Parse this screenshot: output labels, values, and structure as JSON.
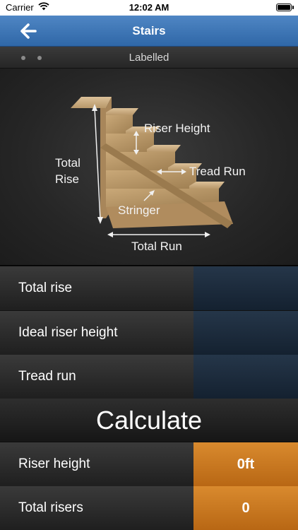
{
  "status": {
    "carrier": "Carrier",
    "time": "12:02 AM"
  },
  "nav": {
    "title": "Stairs"
  },
  "pager": {
    "label": "Labelled"
  },
  "diagram": {
    "total_rise_line1": "Total",
    "total_rise_line2": "Rise",
    "riser_height": "Riser Height",
    "tread_run": "Tread Run",
    "stringer": "Stringer",
    "total_run": "Total Run"
  },
  "inputs": [
    {
      "label": "Total rise",
      "value": ""
    },
    {
      "label": "Ideal riser height",
      "value": ""
    },
    {
      "label": "Tread run",
      "value": ""
    }
  ],
  "calculate_label": "Calculate",
  "results": [
    {
      "label": "Riser height",
      "value": "0ft"
    },
    {
      "label": "Total risers",
      "value": "0"
    }
  ],
  "colors": {
    "nav_blue": "#3b74b5",
    "result_orange": "#c97620",
    "input_blue": "#1d2c3d"
  }
}
